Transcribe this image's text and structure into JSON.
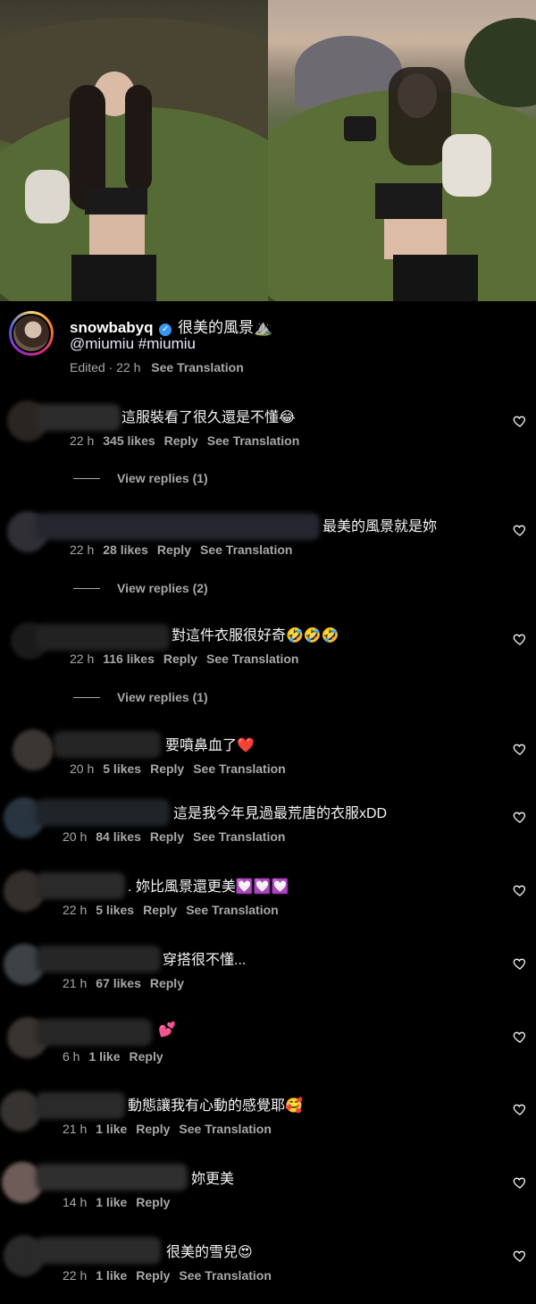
{
  "caption": {
    "username": "snowbabyq",
    "text": "很美的風景⛰️",
    "mentions": "@miumiu #miumiu",
    "edited": "Edited · 22 h",
    "see_translation": "See Translation"
  },
  "comments": [
    {
      "text": "這服裝看了很久還是不懂😂",
      "time": "22 h",
      "likes": "345 likes",
      "reply": "Reply",
      "translate": "See Translation",
      "view_replies": "View replies (1)"
    },
    {
      "text": "最美的風景就是妳",
      "time": "22 h",
      "likes": "28 likes",
      "reply": "Reply",
      "translate": "See Translation",
      "view_replies": "View replies (2)"
    },
    {
      "text": "對這件衣服很好奇🤣🤣🤣",
      "time": "22 h",
      "likes": "116 likes",
      "reply": "Reply",
      "translate": "See Translation",
      "view_replies": "View replies (1)"
    },
    {
      "text": "要噴鼻血了❤️",
      "time": "20 h",
      "likes": "5 likes",
      "reply": "Reply",
      "translate": "See Translation"
    },
    {
      "text": "這是我今年見過最荒唐的衣服xDD",
      "time": "20 h",
      "likes": "84 likes",
      "reply": "Reply",
      "translate": "See Translation"
    },
    {
      "text": ". 妳比風景還更美💟💟💟",
      "time": "22 h",
      "likes": "5 likes",
      "reply": "Reply",
      "translate": "See Translation"
    },
    {
      "text": "穿搭很不懂...",
      "time": "21 h",
      "likes": "67 likes",
      "reply": "Reply"
    },
    {
      "text": "💕",
      "time": "6 h",
      "likes": "1 like",
      "reply": "Reply"
    },
    {
      "text": "動態讓我有心動的感覺耶🥰",
      "time": "21 h",
      "likes": "1 like",
      "reply": "Reply",
      "translate": "See Translation"
    },
    {
      "text": "妳更美",
      "time": "14 h",
      "likes": "1 like",
      "reply": "Reply"
    },
    {
      "text": "很美的雪兒😍",
      "time": "22 h",
      "likes": "1 like",
      "reply": "Reply",
      "translate": "See Translation"
    }
  ],
  "colors": {
    "background": "#000000",
    "text": "#f5f5f5",
    "muted": "#a8a8a8",
    "verified": "#3897f0"
  }
}
